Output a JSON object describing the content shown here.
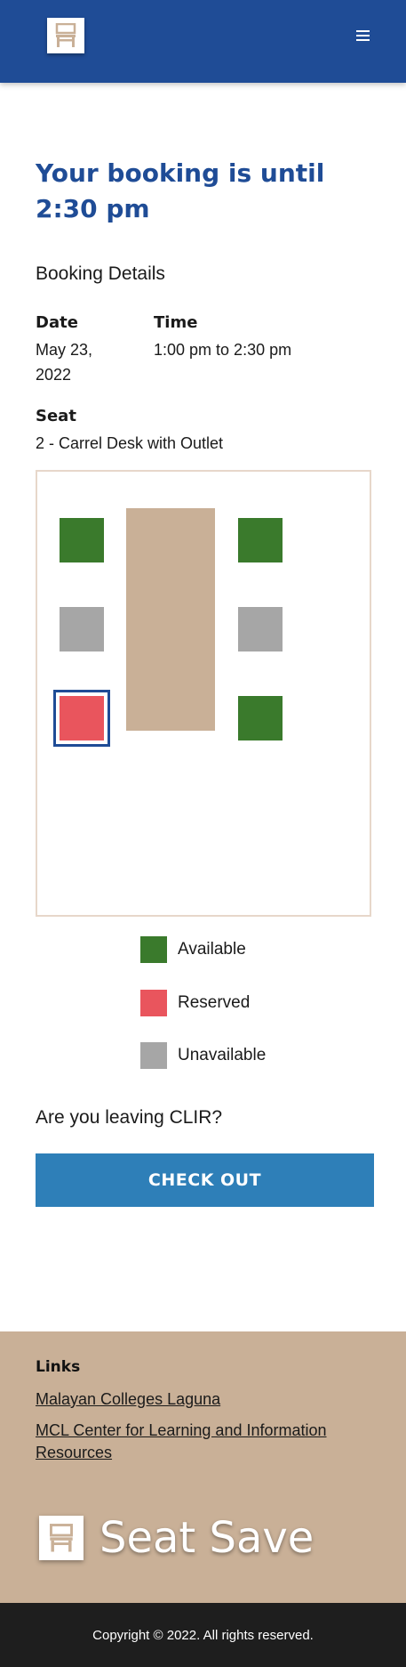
{
  "header": {
    "logo_icon": "chair-icon",
    "menu_icon": "hamburger-icon"
  },
  "main": {
    "title": "Your booking is until 2:30 pm",
    "subtitle": "Booking Details",
    "date_label": "Date",
    "date_value": "May 23, 2022",
    "time_label": "Time",
    "time_value": "1:00 pm to 2:30 pm",
    "seat_label": "Seat",
    "seat_value": "2 - Carrel Desk with Outlet",
    "legend": [
      {
        "label": "Available",
        "color": "#3a7a2c"
      },
      {
        "label": "Reserved",
        "color": "#e9555d"
      },
      {
        "label": "Unavailable",
        "color": "#a6a6a6"
      }
    ],
    "question": "Are you leaving CLIR?",
    "checkout_label": "CHECK OUT"
  },
  "footer": {
    "links_title": "Links",
    "links": [
      "Malayan Colleges Laguna",
      "MCL Center for Learning and Information Resources"
    ],
    "brand": "Seat Save",
    "copyright": "Copyright © 2022. All rights reserved."
  },
  "colors": {
    "primary": "#1f4c96",
    "button": "#2e7fb8",
    "footer_bg": "#c9b097",
    "available": "#3a7a2c",
    "reserved": "#e9555d",
    "unavailable": "#a6a6a6"
  }
}
